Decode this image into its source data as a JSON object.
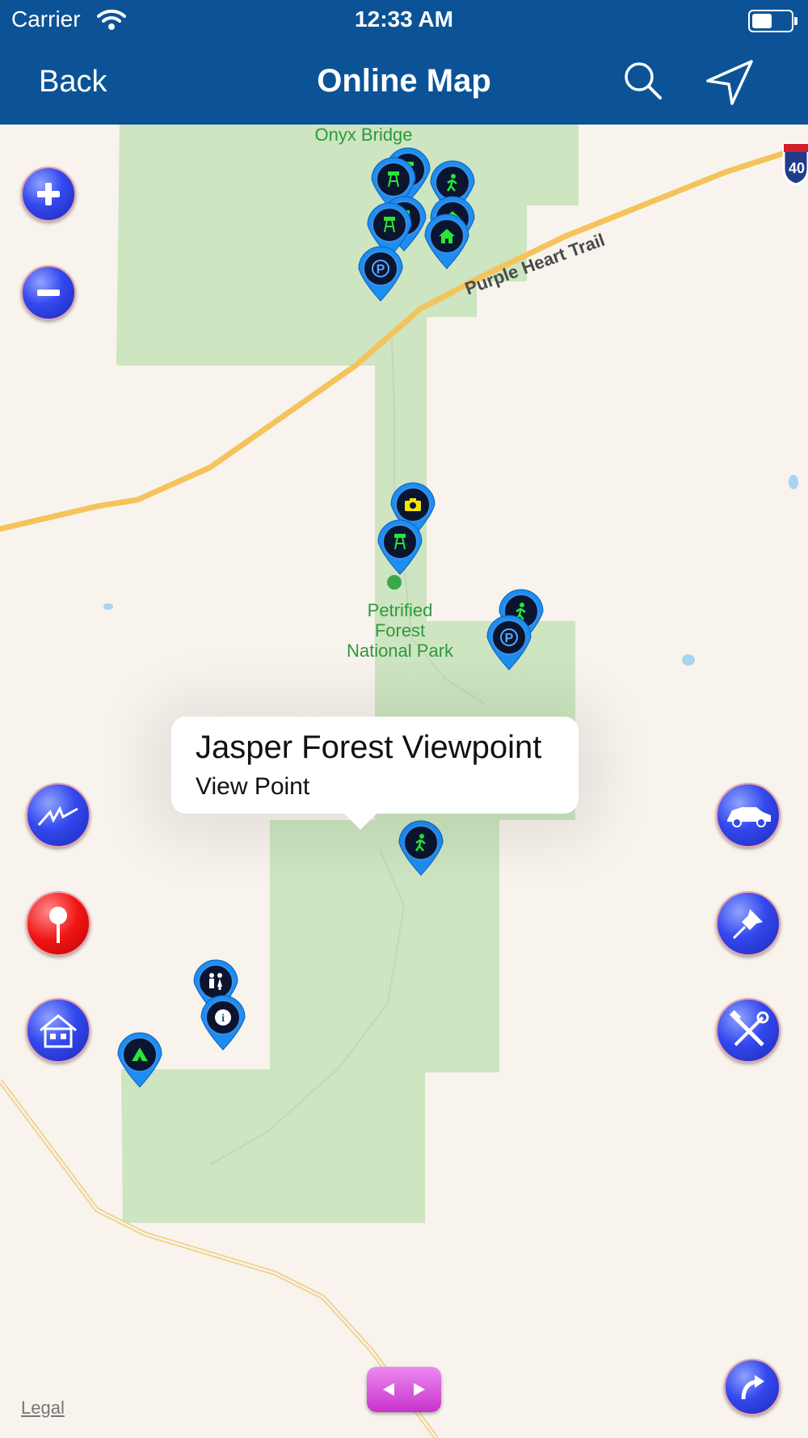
{
  "status_bar": {
    "carrier": "Carrier",
    "time": "12:33 AM"
  },
  "nav": {
    "back_label": "Back",
    "title": "Online Map"
  },
  "map": {
    "labels": {
      "onyx_bridge": "Onyx Bridge",
      "purple_heart_trail": "Purple Heart Trail",
      "park_line1": "Petrified",
      "park_line2": "Forest",
      "park_line3": "National Park",
      "interstate": "40"
    },
    "pin_types": [
      "tower",
      "hiker",
      "home",
      "parking",
      "camera",
      "restroom",
      "info",
      "tent"
    ],
    "legal": "Legal"
  },
  "callout": {
    "title": "Jasper Forest Viewpoint",
    "subtitle": "View Point"
  },
  "controls": {
    "left": [
      "zoom-in-icon",
      "zoom-out-icon",
      "elevation-icon",
      "pin-icon",
      "house-icon"
    ],
    "right": [
      "car-icon",
      "pushpin-icon",
      "tools-icon",
      "share-icon"
    ],
    "bottom": "left-right-arrows-icon"
  },
  "colors": {
    "nav_bar": "#0b5396",
    "park_fill": "#cde5c0",
    "road": "#f5c35b",
    "pin_blue": "#1d8df2",
    "pin_icon_green": "#29e53a",
    "pin_icon_yellow": "#f5e600",
    "button_blue": "#3348ee",
    "button_red": "#f01414",
    "bottom_button": "#d545d8"
  }
}
